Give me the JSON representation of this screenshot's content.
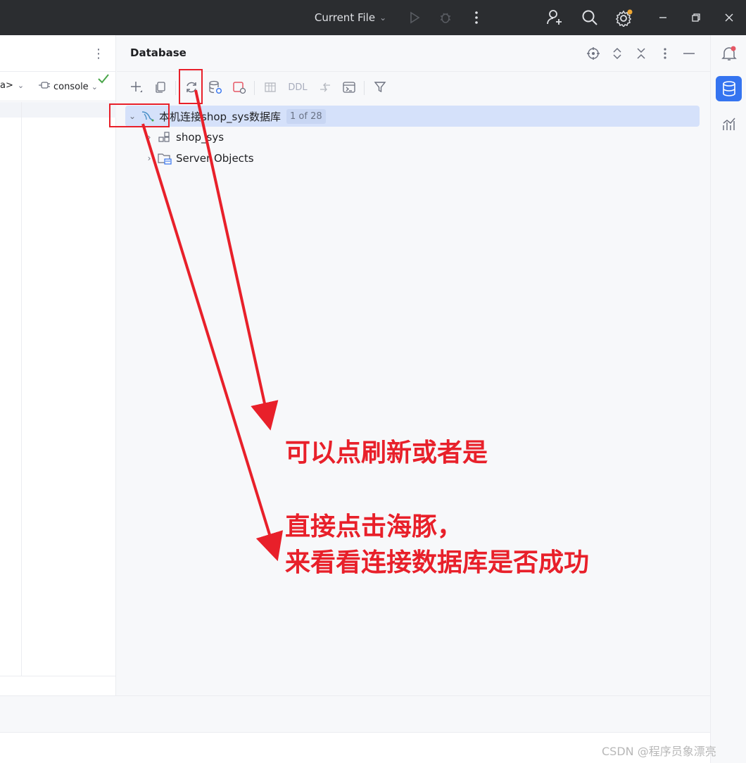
{
  "titlebar": {
    "run_config": "Current File",
    "icons": [
      "run-icon",
      "debug-icon",
      "more-vert-icon",
      "add-user-icon",
      "search-icon",
      "settings-icon",
      "minimize-icon",
      "restore-icon",
      "close-icon"
    ]
  },
  "left": {
    "schema_fragment": "a>",
    "console_label": "console"
  },
  "database": {
    "title": "Database",
    "toolbar": {
      "ddl_label": "DDL"
    },
    "tree": {
      "connection_name": "本机连接shop_sys数据库",
      "badge": "1 of 28",
      "children": [
        {
          "label": "shop_sys",
          "icon": "schema-icon"
        },
        {
          "label": "Server Objects",
          "icon": "server-objects-icon"
        }
      ]
    }
  },
  "annotations": {
    "line1": "可以点刷新或者是",
    "line2": "直接点击海豚，",
    "line3": "来看看连接数据库是否成功",
    "color": "#e8202a"
  },
  "watermark": "CSDN @程序员象漂亮"
}
